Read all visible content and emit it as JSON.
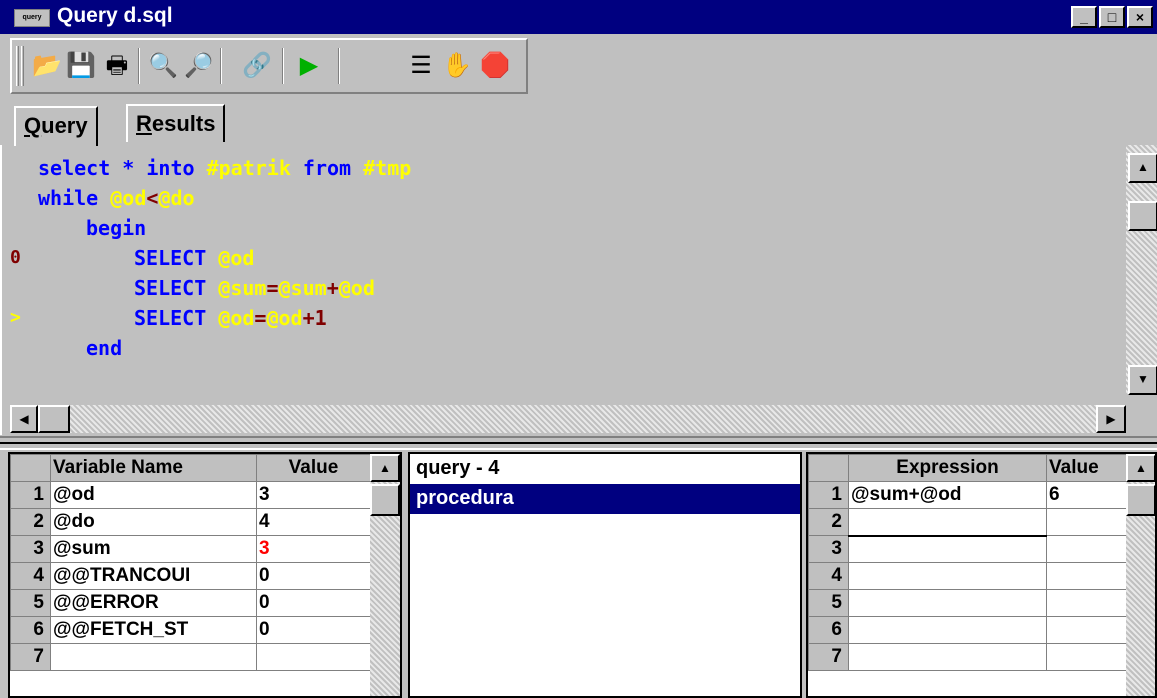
{
  "window": {
    "title": "Query d.sql",
    "icon_label": "query",
    "minimize_glyph": "_",
    "maximize_glyph": "□",
    "close_glyph": "×"
  },
  "toolbar": {
    "buttons": [
      {
        "name": "open-folder-icon",
        "glyph": "📂"
      },
      {
        "name": "save-icon",
        "glyph": "💾"
      },
      {
        "name": "print-icon",
        "glyph": "🖶"
      },
      {
        "name": "find-icon",
        "glyph": "🔍"
      },
      {
        "name": "find-next-icon",
        "glyph": "🔎"
      },
      {
        "name": "connect-icon",
        "glyph": "🔗"
      },
      {
        "name": "run-icon",
        "glyph": "▶"
      },
      {
        "name": "step-into-icon",
        "glyph": "☰"
      },
      {
        "name": "hand-icon",
        "glyph": "✋"
      },
      {
        "name": "stop-hand-icon",
        "glyph": "🛑"
      }
    ]
  },
  "tabs": {
    "query_prefix": "Q",
    "query_rest": "uery",
    "results_prefix": "R",
    "results_rest": "esults"
  },
  "code": {
    "line1": {
      "kw1": "select * into ",
      "v1": "#patrik",
      "kw2": " from ",
      "v2": "#tmp"
    },
    "line2": {
      "kw1": "while ",
      "v1": "@od",
      "op1": "<",
      "v2": "@do"
    },
    "line3": {
      "kw1": "begin"
    },
    "line4": {
      "gutter": "0",
      "kw1": "SELECT ",
      "v1": "@od"
    },
    "line5": {
      "kw1": "SELECT ",
      "v1": "@sum",
      "op1": "=",
      "v2": "@sum",
      "op2": "+",
      "v3": "@od"
    },
    "line6": {
      "gutter": ">",
      "kw1": "SELECT ",
      "v1": "@od",
      "op1": "=",
      "v2": "@od",
      "op2": "+1"
    },
    "line7": {
      "kw1": "end"
    }
  },
  "variables": {
    "col_name": "Variable Name",
    "col_value": "Value",
    "rows": [
      {
        "n": "1",
        "name": "@od",
        "value": "3"
      },
      {
        "n": "2",
        "name": "@do",
        "value": "4"
      },
      {
        "n": "3",
        "name": "@sum",
        "value": "3"
      },
      {
        "n": "4",
        "name": "@@TRANCOUI",
        "value": "0"
      },
      {
        "n": "5",
        "name": "@@ERROR",
        "value": "0"
      },
      {
        "n": "6",
        "name": "@@FETCH_ST",
        "value": "0"
      },
      {
        "n": "7",
        "name": "",
        "value": ""
      }
    ]
  },
  "callstack": {
    "items": [
      "query - 4",
      "procedura"
    ]
  },
  "watch": {
    "col_expr": "Expression",
    "col_value": "Value",
    "rows": [
      {
        "n": "1",
        "expr": "@sum+@od",
        "value": "6"
      },
      {
        "n": "2",
        "expr": "",
        "value": ""
      },
      {
        "n": "3",
        "expr": "",
        "value": ""
      },
      {
        "n": "4",
        "expr": "",
        "value": ""
      },
      {
        "n": "5",
        "expr": "",
        "value": ""
      },
      {
        "n": "6",
        "expr": "",
        "value": ""
      },
      {
        "n": "7",
        "expr": "",
        "value": ""
      }
    ]
  },
  "colors": {
    "titlebar": "#000080",
    "keyword": "#0000ff",
    "variable": "#ffff00",
    "operator": "#800000",
    "changed_value": "#ff0000"
  }
}
